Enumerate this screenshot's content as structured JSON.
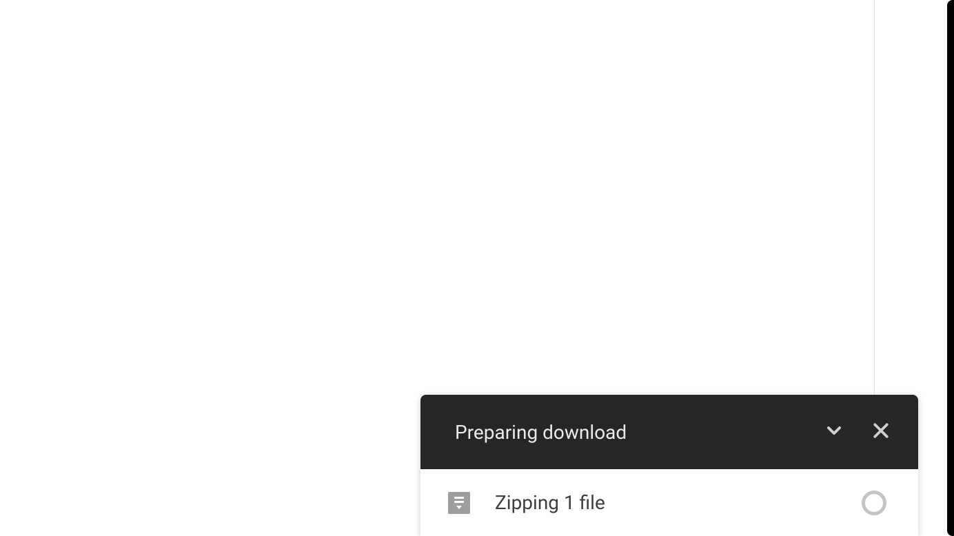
{
  "toast": {
    "title": "Preparing download",
    "status": "Zipping 1 file"
  }
}
